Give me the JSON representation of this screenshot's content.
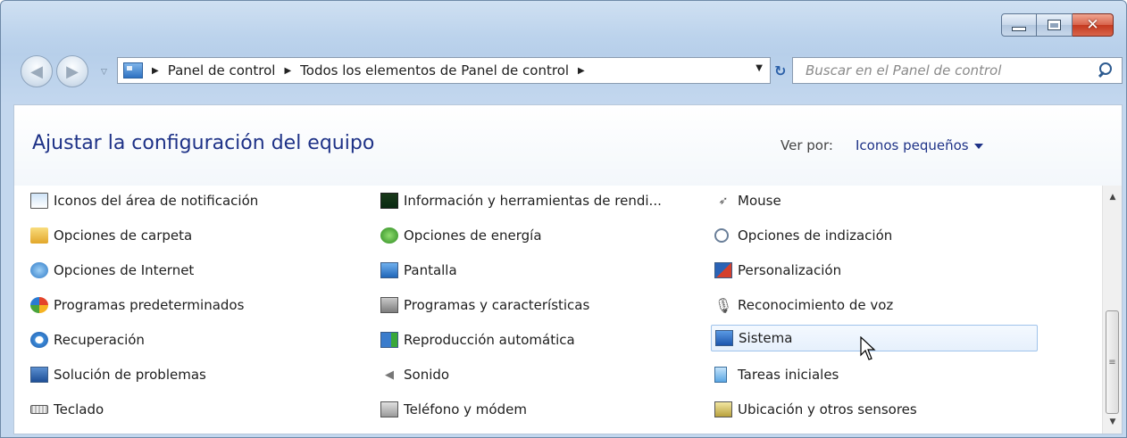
{
  "window": {
    "min_label": "",
    "max_label": "",
    "close_label": "✕"
  },
  "nav": {
    "breadcrumb": [
      "Panel de control",
      "Todos los elementos de Panel de control"
    ],
    "search_placeholder": "Buscar en el Panel de control"
  },
  "header": {
    "title": "Ajustar la configuración del equipo",
    "view_by_label": "Ver por:",
    "view_by_value": "Iconos pequeños"
  },
  "items": {
    "col1": [
      {
        "label": "Iconos del área de notificación",
        "icon": "notification-area-icon"
      },
      {
        "label": "Opciones de carpeta",
        "icon": "folder-options-icon"
      },
      {
        "label": "Opciones de Internet",
        "icon": "internet-options-icon"
      },
      {
        "label": "Programas predeterminados",
        "icon": "default-programs-icon"
      },
      {
        "label": "Recuperación",
        "icon": "recovery-icon"
      },
      {
        "label": "Solución de problemas",
        "icon": "troubleshooting-icon"
      },
      {
        "label": "Teclado",
        "icon": "keyboard-icon"
      }
    ],
    "col2": [
      {
        "label": "Información y herramientas de rendi...",
        "icon": "performance-info-icon"
      },
      {
        "label": "Opciones de energía",
        "icon": "power-options-icon"
      },
      {
        "label": "Pantalla",
        "icon": "display-icon"
      },
      {
        "label": "Programas y características",
        "icon": "programs-features-icon"
      },
      {
        "label": "Reproducción automática",
        "icon": "autoplay-icon"
      },
      {
        "label": "Sonido",
        "icon": "sound-icon"
      },
      {
        "label": "Teléfono y módem",
        "icon": "phone-modem-icon"
      }
    ],
    "col3": [
      {
        "label": "Mouse",
        "icon": "mouse-icon"
      },
      {
        "label": "Opciones de indización",
        "icon": "indexing-options-icon"
      },
      {
        "label": "Personalización",
        "icon": "personalization-icon"
      },
      {
        "label": "Reconocimiento de voz",
        "icon": "speech-recognition-icon"
      },
      {
        "label": "Sistema",
        "icon": "system-icon"
      },
      {
        "label": "Tareas iniciales",
        "icon": "getting-started-icon"
      },
      {
        "label": "Ubicación y otros sensores",
        "icon": "location-sensors-icon"
      }
    ]
  }
}
